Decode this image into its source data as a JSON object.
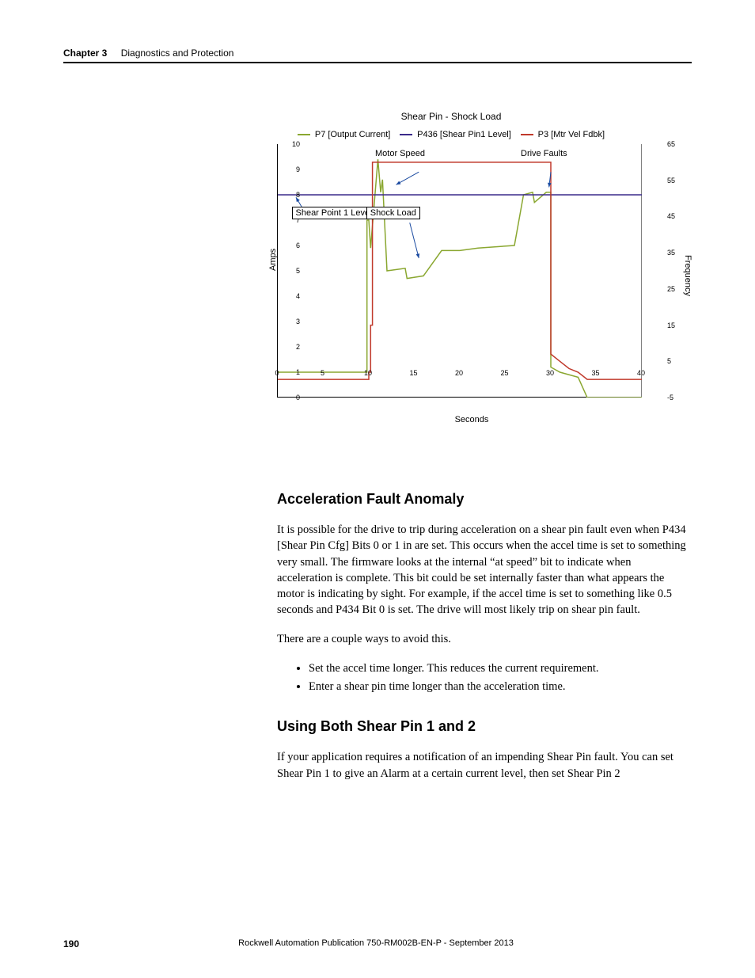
{
  "header": {
    "chapter": "Chapter 3",
    "section": "Diagnostics and Protection"
  },
  "chart_data": {
    "type": "line",
    "title": "Shear Pin - Shock Load",
    "xlabel": "Seconds",
    "ylabel": "Amps",
    "y2label": "Frequency",
    "xlim": [
      0,
      40
    ],
    "ylim": [
      0,
      10
    ],
    "y2lim": [
      -5,
      65
    ],
    "xticks": [
      0,
      5,
      10,
      15,
      20,
      25,
      30,
      35,
      40
    ],
    "yticks": [
      0,
      1,
      2,
      3,
      4,
      5,
      6,
      7,
      8,
      9,
      10
    ],
    "y2ticks": [
      -5,
      5,
      15,
      25,
      35,
      45,
      55,
      65
    ],
    "legend": [
      {
        "name": "P7 [Output Current]",
        "color": "#8aa730"
      },
      {
        "name": "P436 [Shear Pin1 Level]",
        "color": "#3a2a8a"
      },
      {
        "name": "P3 [Mtr Vel Fdbk]",
        "color": "#c0392b"
      }
    ],
    "annotations": [
      {
        "text": "Motor Speed",
        "x": 15,
        "y_amps": 9.2
      },
      {
        "text": "Drive Faults",
        "x": 30,
        "y_amps": 9.2
      },
      {
        "text": "Shear Point 1 Level",
        "x": 5,
        "y_amps": 7.3
      },
      {
        "text": "Shock Load",
        "x": 14,
        "y_amps": 7.3
      }
    ],
    "series": [
      {
        "name": "P7 [Output Current]",
        "color": "#8aa730",
        "axis": "y1",
        "points": [
          [
            0,
            1.0
          ],
          [
            9.8,
            1.0
          ],
          [
            9.8,
            7.0
          ],
          [
            10,
            7.0
          ],
          [
            10.2,
            5.9
          ],
          [
            11,
            9.4
          ],
          [
            11.3,
            8.1
          ],
          [
            11.5,
            8.6
          ],
          [
            12,
            5.0
          ],
          [
            14,
            5.1
          ],
          [
            14.2,
            4.7
          ],
          [
            16,
            4.8
          ],
          [
            18,
            5.8
          ],
          [
            20,
            5.8
          ],
          [
            22,
            5.9
          ],
          [
            26,
            6.0
          ],
          [
            27,
            8.0
          ],
          [
            28,
            8.1
          ],
          [
            28.2,
            7.7
          ],
          [
            29.5,
            8.1
          ],
          [
            30,
            8.1
          ],
          [
            30,
            1.2
          ],
          [
            31,
            1.0
          ],
          [
            33,
            0.8
          ],
          [
            34,
            0.0
          ],
          [
            40,
            0.0
          ]
        ]
      },
      {
        "name": "P436 [Shear Pin1 Level]",
        "color": "#3a2a8a",
        "axis": "y1",
        "points": [
          [
            0,
            8.0
          ],
          [
            40,
            8.0
          ]
        ]
      },
      {
        "name": "P3 [Mtr Vel Fdbk]",
        "color": "#c0392b",
        "axis": "y2",
        "points": [
          [
            0,
            0
          ],
          [
            10,
            0
          ],
          [
            10,
            2
          ],
          [
            10.2,
            2
          ],
          [
            10.2,
            15
          ],
          [
            10.4,
            15
          ],
          [
            10.4,
            60
          ],
          [
            30,
            60
          ],
          [
            30,
            7
          ],
          [
            31,
            5
          ],
          [
            32,
            3
          ],
          [
            33,
            2
          ],
          [
            34,
            0
          ],
          [
            40,
            0
          ]
        ]
      }
    ]
  },
  "section1": {
    "heading": "Acceleration Fault Anomaly",
    "para1": "It is possible for the drive to trip during acceleration on a shear pin fault even when P434 [Shear Pin Cfg] Bits 0 or 1 in are set. This occurs when the accel time is set to something very small. The firmware looks at the internal “at speed” bit to indicate when acceleration is complete. This bit could be set internally faster than what appears the motor is indicating by sight. For example, if the accel time is set to something like 0.5 seconds and P434 Bit 0 is set. The drive will most likely trip on shear pin fault.",
    "para2": "There are a couple ways to avoid this.",
    "bullets": [
      "Set the accel time longer. This reduces the current requirement.",
      "Enter a shear pin time longer than the acceleration time."
    ]
  },
  "section2": {
    "heading": "Using Both Shear Pin 1 and 2",
    "para1": "If your application requires a notification of an impending Shear Pin fault. You can set Shear Pin 1 to give an Alarm at a certain current level, then set Shear Pin 2"
  },
  "footer": {
    "page": "190",
    "pub": "Rockwell Automation Publication 750-RM002B-EN-P - September 2013"
  }
}
